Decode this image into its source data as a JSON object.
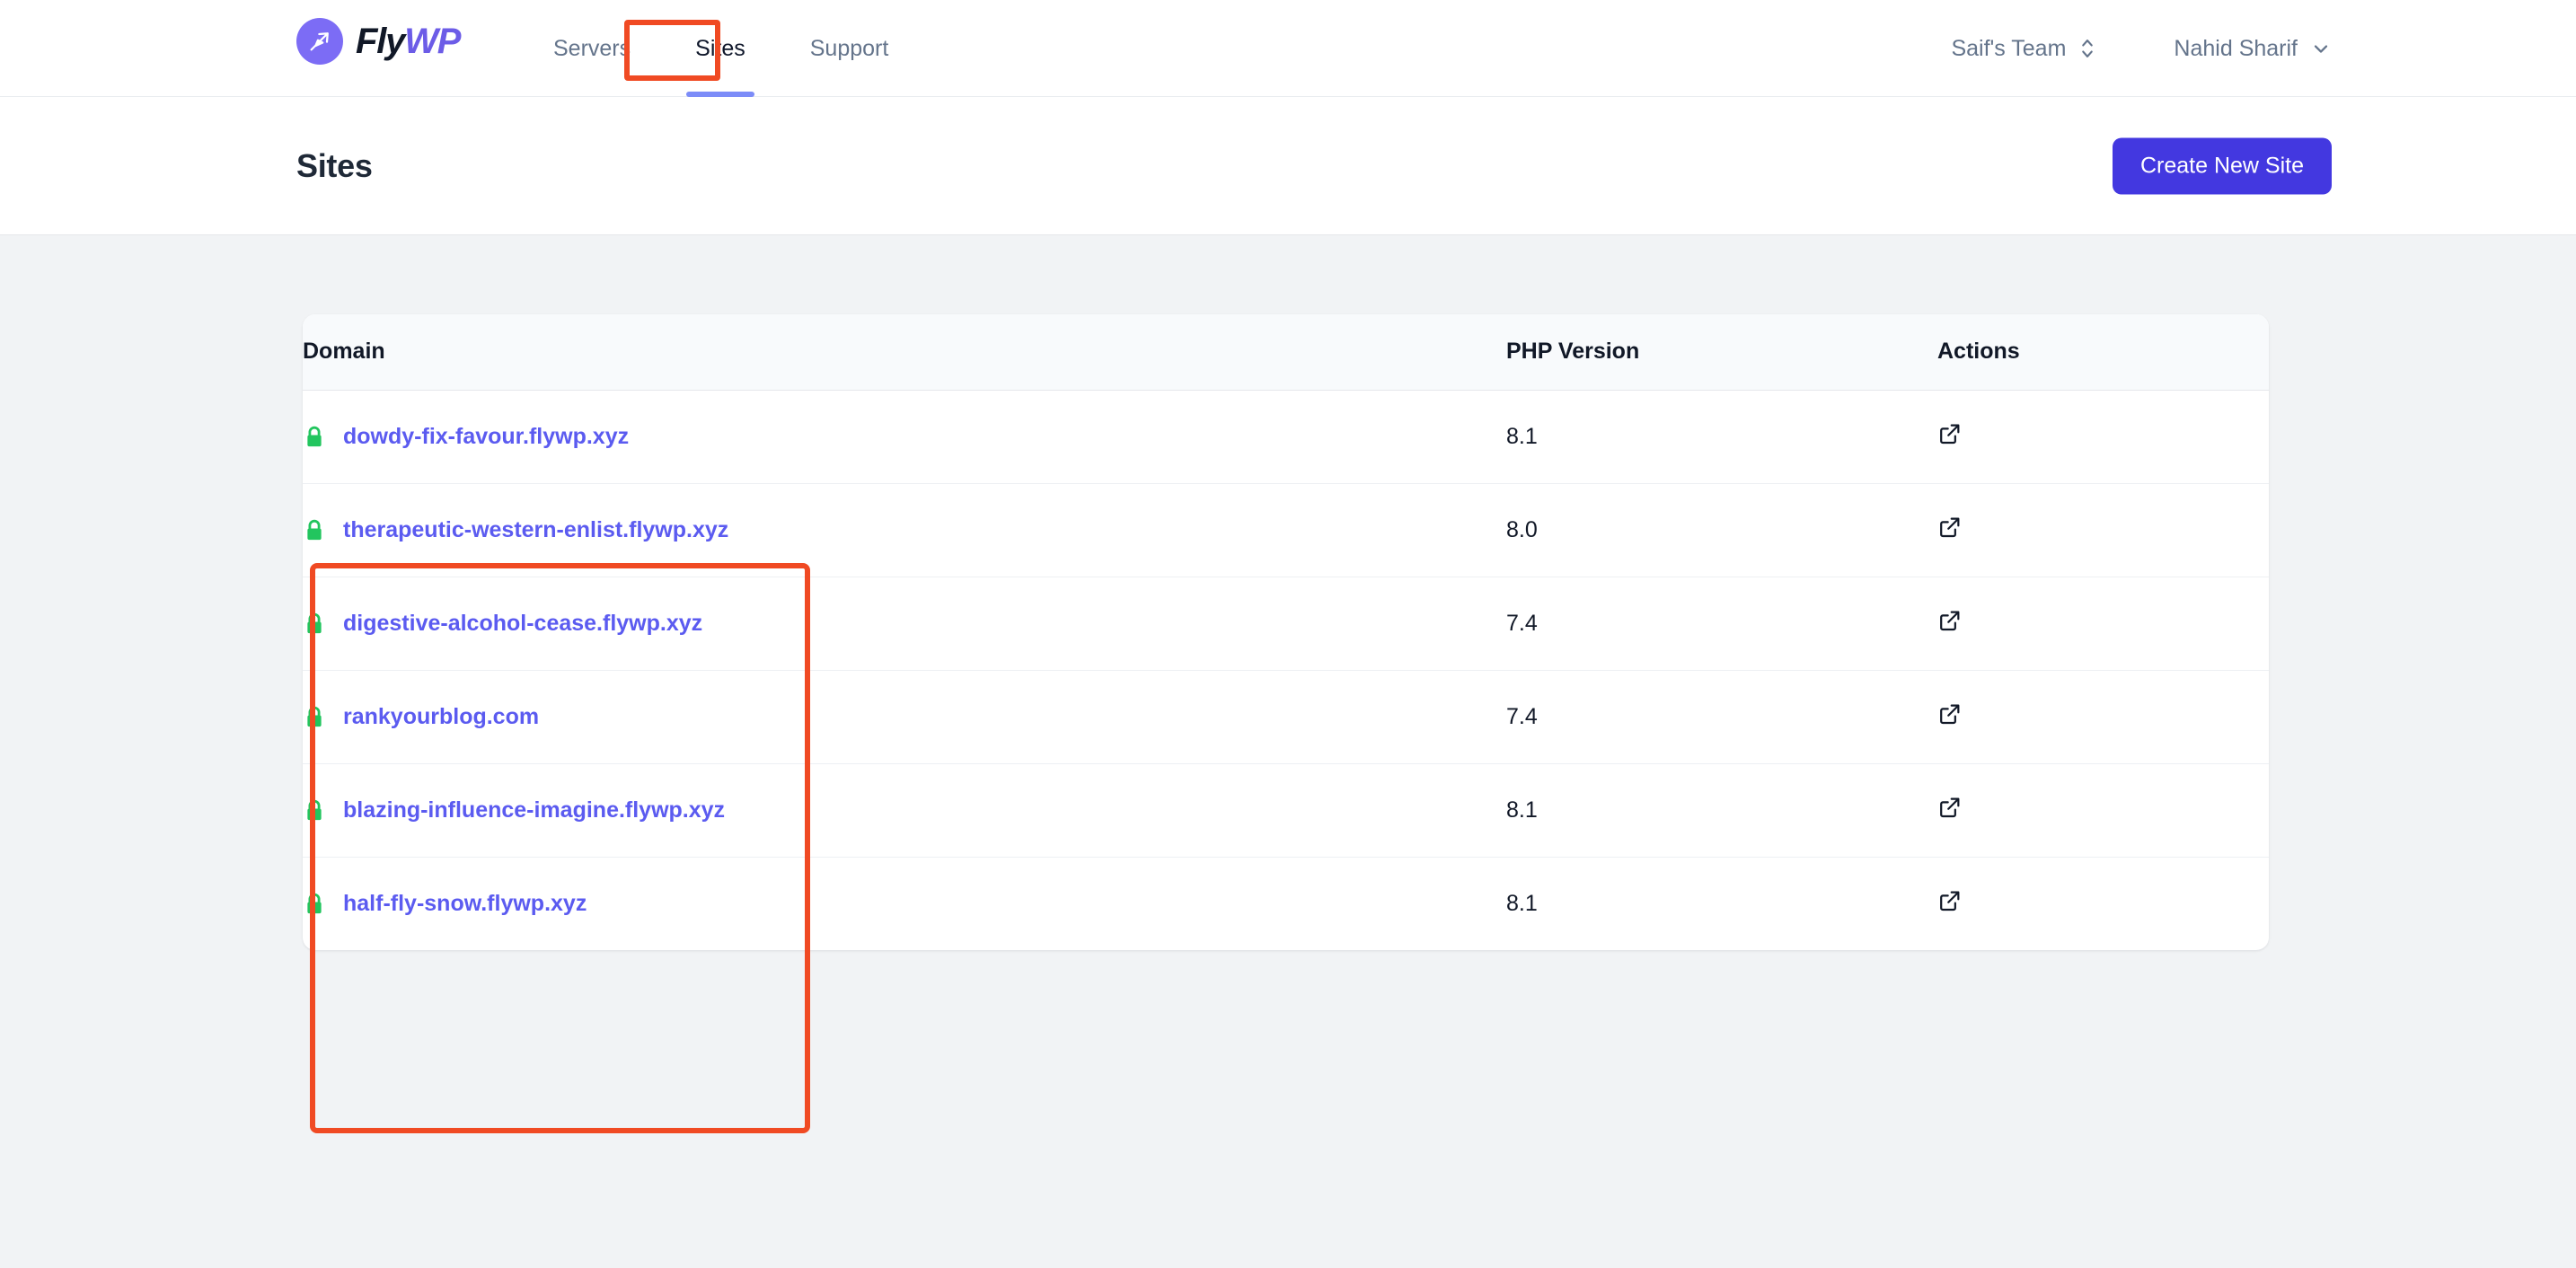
{
  "brand": {
    "name_part1": "Fly",
    "name_part2": "WP",
    "logo_icon": "paper-plane-icon",
    "accent_color": "#6c5ce7"
  },
  "nav": {
    "items": [
      {
        "label": "Servers",
        "active": false
      },
      {
        "label": "Sites",
        "active": true
      },
      {
        "label": "Support",
        "active": false
      }
    ],
    "team_switcher": {
      "label": "Saif's Team",
      "icon": "chevron-up-down-icon"
    },
    "user_menu": {
      "label": "Nahid Sharif",
      "icon": "chevron-down-icon"
    }
  },
  "page": {
    "title": "Sites",
    "create_button_label": "Create New Site"
  },
  "table": {
    "columns": [
      "Domain",
      "PHP Version",
      "Actions"
    ],
    "rows": [
      {
        "ssl_icon": "lock-icon",
        "domain": "dowdy-fix-favour.flywp.xyz",
        "php_version": "8.1",
        "action_icon": "external-link-icon"
      },
      {
        "ssl_icon": "lock-icon",
        "domain": "therapeutic-western-enlist.flywp.xyz",
        "php_version": "8.0",
        "action_icon": "external-link-icon"
      },
      {
        "ssl_icon": "lock-icon",
        "domain": "digestive-alcohol-cease.flywp.xyz",
        "php_version": "7.4",
        "action_icon": "external-link-icon"
      },
      {
        "ssl_icon": "lock-icon",
        "domain": "rankyourblog.com",
        "php_version": "7.4",
        "action_icon": "external-link-icon"
      },
      {
        "ssl_icon": "lock-icon",
        "domain": "blazing-influence-imagine.flywp.xyz",
        "php_version": "8.1",
        "action_icon": "external-link-icon"
      },
      {
        "ssl_icon": "lock-icon",
        "domain": "half-fly-snow.flywp.xyz",
        "php_version": "8.1",
        "action_icon": "external-link-icon"
      }
    ]
  },
  "annotations": {
    "color": "#f04a23",
    "highlight_boxes": [
      "sites-tab",
      "domain-column"
    ],
    "arrow_points_to": "create-new-site-button"
  },
  "colors": {
    "primary_button": "#4338e0",
    "link": "#5b5bf0",
    "ssl_lock": "#22c55e",
    "page_background": "#f1f3f5",
    "table_header_background": "#f8fafc",
    "nav_active_underline": "#7c8cf8"
  }
}
